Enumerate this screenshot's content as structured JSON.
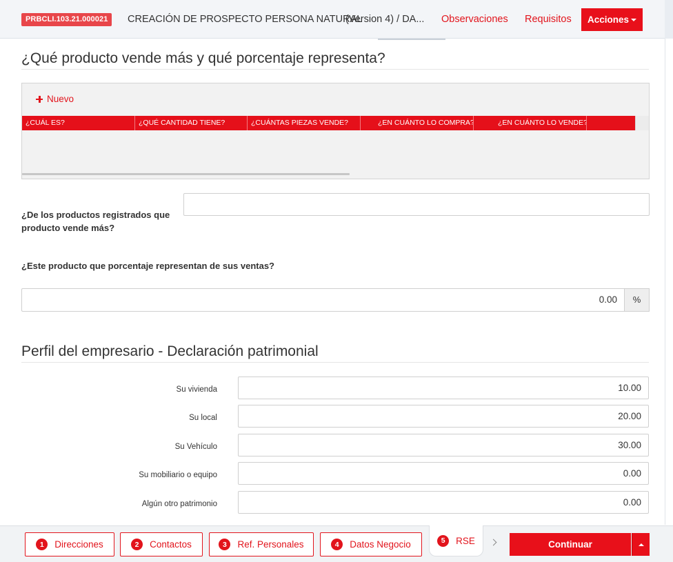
{
  "header": {
    "case_id": "PRBCLI.103.21.000021",
    "title": "CREACIÓN DE PROSPECTO PERSONA NATURAL",
    "version": "(Version 4) / DA...",
    "links": {
      "observaciones": "Observaciones",
      "requisitos": "Requisitos"
    },
    "acciones_label": "Acciones",
    "accent_color": "#e8101a"
  },
  "products_section": {
    "title": "¿Qué producto vende más y qué porcentaje representa?",
    "new_label": "Nuevo",
    "columns": [
      "¿CUÁL ES?",
      "¿QUÉ CANTIDAD TIENE?",
      "¿CUÁNTAS PIEZAS VENDE?",
      "¿EN CUÁNTO LO COMPRA?",
      "¿EN CUÁNTO LO VENDE?",
      ""
    ],
    "rows": [],
    "top_product_label": "¿De los productos registrados que producto vende más?",
    "top_product_value": "",
    "percent_label": "¿Este producto que porcentaje representan de sus ventas?",
    "percent_value": "0.00",
    "percent_addon": "%"
  },
  "assets_section": {
    "title": "Perfil del empresario - Declaración patrimonial",
    "items": [
      {
        "label": "Su vivienda",
        "value": "10.00"
      },
      {
        "label": "Su local",
        "value": "20.00"
      },
      {
        "label": "Su Vehículo",
        "value": "30.00"
      },
      {
        "label": "Su mobiliario o equipo",
        "value": "0.00"
      },
      {
        "label": "Algún otro patrimonio",
        "value": "0.00"
      }
    ]
  },
  "footer": {
    "steps": [
      {
        "num": "1",
        "label": "Direcciones"
      },
      {
        "num": "2",
        "label": "Contactos"
      },
      {
        "num": "3",
        "label": "Ref. Personales"
      },
      {
        "num": "4",
        "label": "Datos Negocio"
      },
      {
        "num": "5",
        "label": "RSE"
      }
    ],
    "active_step": "5",
    "continue_label": "Continuar"
  }
}
